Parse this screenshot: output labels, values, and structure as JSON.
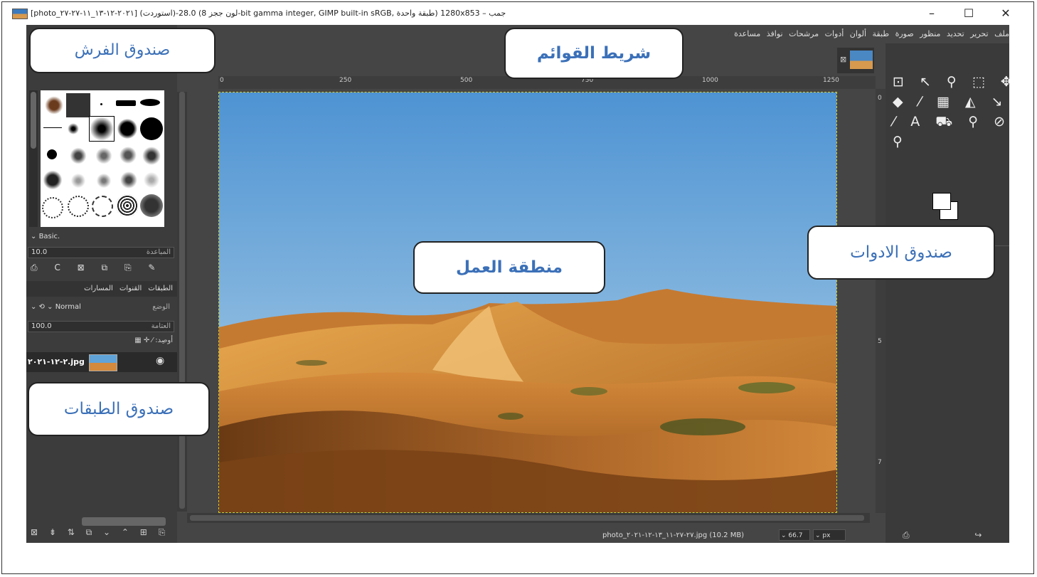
{
  "window": {
    "title": "[photo_٢٠٢١-١٢-١٣_١١-٢٧-٢٧] (استوردت)-28.0 (لون ججز 8-bit gamma integer, GIMP built-in sRGB, طبقة واحدة) 1280x853 – جمب",
    "minimize_label": "–",
    "maximize_label": "☐",
    "close_label": "✕",
    "app_icon": "gimp-image-icon"
  },
  "menubar": {
    "items": [
      "ملف",
      "تحرير",
      "تحديد",
      "منظور",
      "صورة",
      "طبقة",
      "ألوان",
      "أدوات",
      "مرشحات",
      "نوافذ",
      "مساعدة"
    ]
  },
  "brushes": {
    "preset": "Basic.",
    "spacing_value": "10.0",
    "spacing_label": "المباعدة",
    "action_icons": [
      "⎙",
      "C",
      "⊠",
      "⧉",
      "⎘",
      "✎"
    ]
  },
  "layers": {
    "tabs": [
      "الطبقات",
      "القنوات",
      "المسارات"
    ],
    "mode_label": "الوضع",
    "mode_value": "Normal",
    "opacity_label": "العتامة",
    "opacity_value": "100.0",
    "lock_label": "أوصِد:",
    "layer_name": "٢-١٢-٢٠٢١.jpg",
    "bottom_icons": "⊠ ⇟ ⇅ ⧉ ⌄ ⌃ ⊞ ⎘"
  },
  "ruler": {
    "ticks": [
      "0",
      "250",
      "500",
      "750",
      "1000",
      "1250"
    ],
    "vticks": [
      "0",
      "5",
      "7"
    ]
  },
  "statusbar": {
    "file": "photo_٢٧-٢٧-١١_١٣-١٢-٢٠٢١.jpg (10.2 MB)",
    "zoom": "66.7 %",
    "unit": "px"
  },
  "toolbox": {
    "rows": [
      "⊡ ↖ ⚲ ⬚ ✥",
      "◆ ⁄ ▦ ◭ ↘",
      "⁄ A ⛟ ⚲ ⊘",
      "        ⚲"
    ],
    "bottom_icons": "⎙ ↪ ↩"
  },
  "callouts": {
    "brush_box": "صندوق الفرش",
    "menu_bar": "شريط القوائم",
    "work_area": "منطقة العمل",
    "toolbox": "صندوق الادوات",
    "layers_box": "صندوق الطبقات"
  },
  "colors": {
    "accent": "#3b70b8",
    "app_bg": "#454545",
    "sky_top": "#4e93d3",
    "sand": "#d58a3a"
  }
}
